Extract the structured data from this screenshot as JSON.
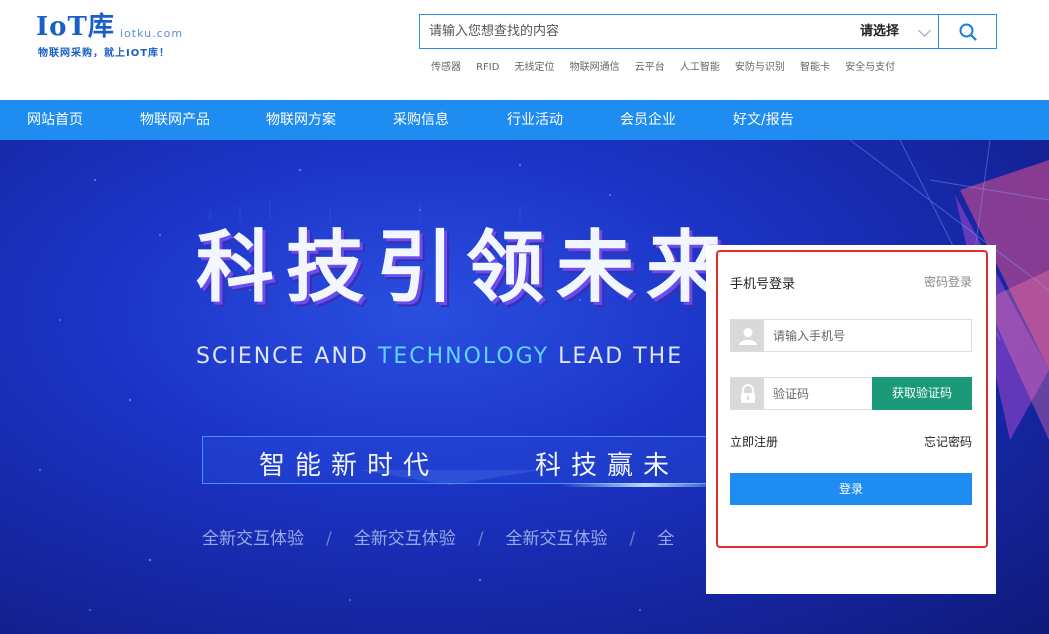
{
  "logo": {
    "main": "IoT库",
    "domain": "iotku.com",
    "slogan": "物联网采购，就上IOT库！"
  },
  "search": {
    "placeholder": "请输入您想查找的内容",
    "select_label": "请选择",
    "icon": "search-icon"
  },
  "hot_tags": [
    "传感器",
    "RFID",
    "无线定位",
    "物联网通信",
    "云平台",
    "人工智能",
    "安防与识别",
    "智能卡",
    "安全与支付"
  ],
  "nav": {
    "items": [
      "网站首页",
      "物联网产品",
      "物联网方案",
      "采购信息",
      "行业活动",
      "会员企业",
      "好文/报告"
    ]
  },
  "banner": {
    "title": "科技引领未来",
    "subtitle_prefix": "SCIENCE AND ",
    "subtitle_accent": "TECHNOLOGY",
    "subtitle_suffix": " LEAD THE",
    "box_text_1": "智能新时代",
    "box_text_2": "科技赢未",
    "features": [
      "全新交互体验",
      "全新交互体验",
      "全新交互体验",
      "全"
    ],
    "separator": "/"
  },
  "login": {
    "title": "手机号登录",
    "alt_login": "密码登录",
    "phone_placeholder": "请输入手机号",
    "code_placeholder": "验证码",
    "get_code": "获取验证码",
    "register": "立即注册",
    "forgot": "忘记密码",
    "submit": "登录"
  },
  "colors": {
    "brand_blue": "#1e8cf0",
    "code_green": "#1a9a78",
    "highlight_red": "#e82a2a"
  }
}
